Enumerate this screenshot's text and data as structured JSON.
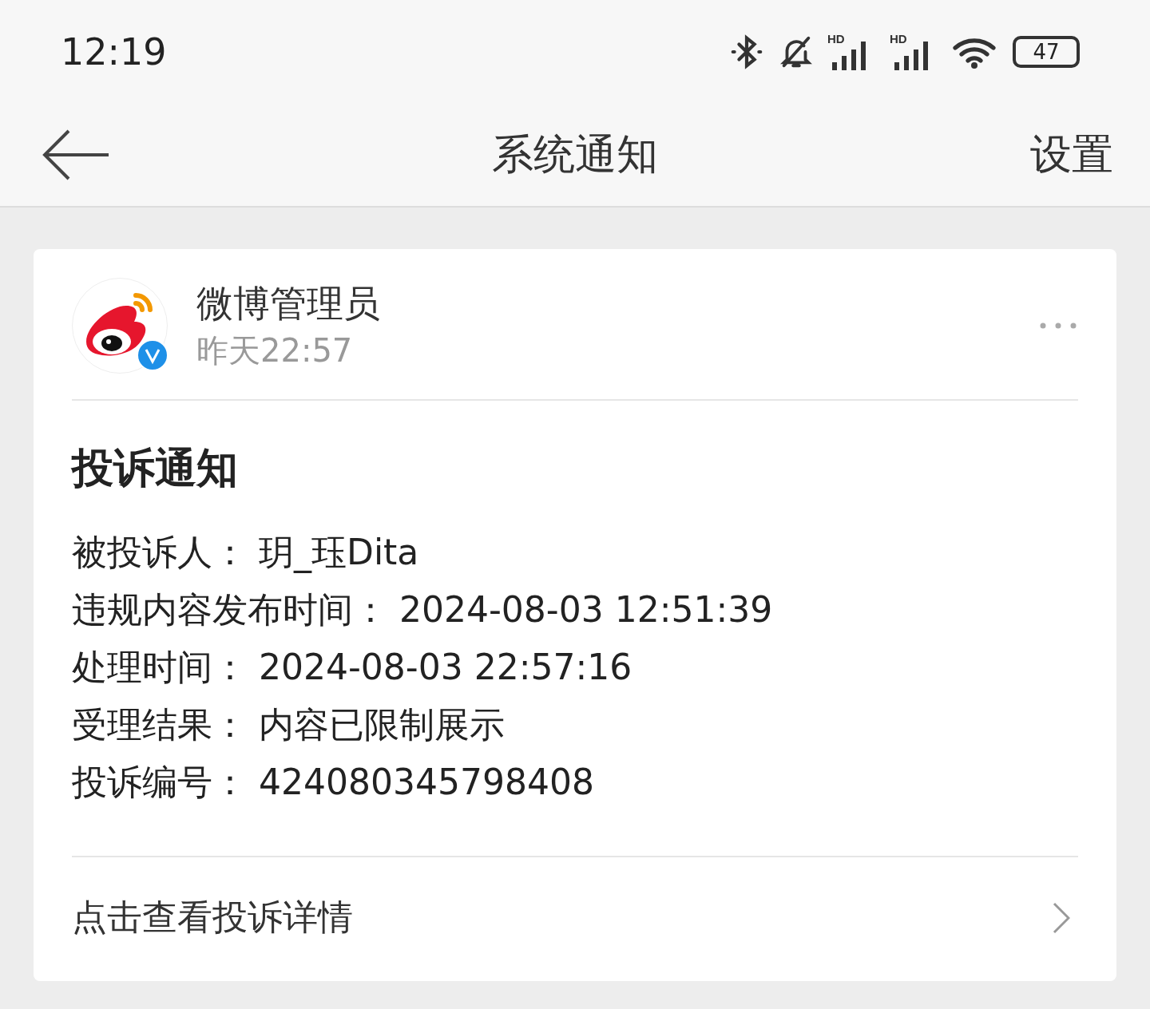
{
  "status_bar": {
    "time": "12:19",
    "battery": "47",
    "signal_labels": [
      "HD",
      "HD"
    ]
  },
  "header": {
    "title": "系统通知",
    "action": "设置"
  },
  "card": {
    "sender": "微博管理员",
    "time": "昨天22:57",
    "heading": "投诉通知",
    "fields": [
      {
        "label": "被投诉人：",
        "value": "玥_珏Dita"
      },
      {
        "label": "违规内容发布时间：",
        "value": "2024-08-03 12:51:39"
      },
      {
        "label": "处理时间：",
        "value": "2024-08-03 22:57:16"
      },
      {
        "label": "受理结果：",
        "value": "内容已限制展示"
      },
      {
        "label": "投诉编号：",
        "value": "424080345798408"
      }
    ],
    "link": "点击查看投诉详情"
  }
}
